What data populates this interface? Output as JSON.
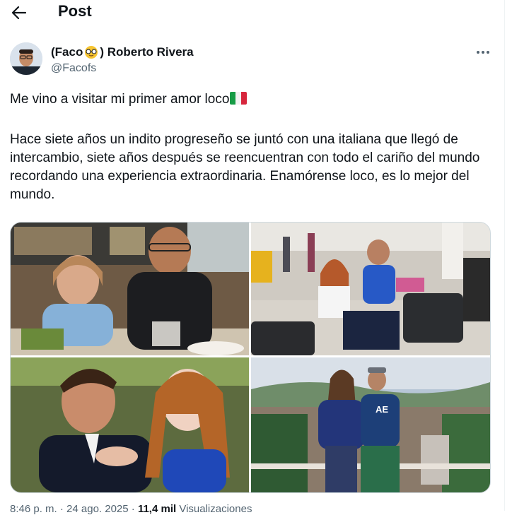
{
  "header": {
    "title": "Post",
    "back_icon": "arrow-left-icon"
  },
  "author": {
    "name_prefix": "(Faco",
    "name_emoji": "nerd-face-emoji",
    "name_suffix": ") Roberto Rivera",
    "handle": "@Facofs"
  },
  "post": {
    "line1": "Me vino a visitar mi primer amor loco",
    "line1_emoji": "italy-flag-emoji",
    "body": "Hace siete años un indito progreseño se juntó con una italiana que llegó de intercambio, siete años después se reencuentran con todo el cariño del mundo recordando una experiencia extraordinaria. Enamórense loco, es lo mejor del mundo."
  },
  "media": [
    {
      "description": "photo-restaurant"
    },
    {
      "description": "photo-airport"
    },
    {
      "description": "photo-dance"
    },
    {
      "description": "photo-viewpoint"
    }
  ],
  "footer": {
    "time": "8:46 p. m. · 24 ago. 2025 · ",
    "views": "11,4 mil",
    "views_label": " Visualizaciones"
  },
  "colors": {
    "text": "#0f1419",
    "muted": "#536471",
    "border": "#cfd9de"
  }
}
